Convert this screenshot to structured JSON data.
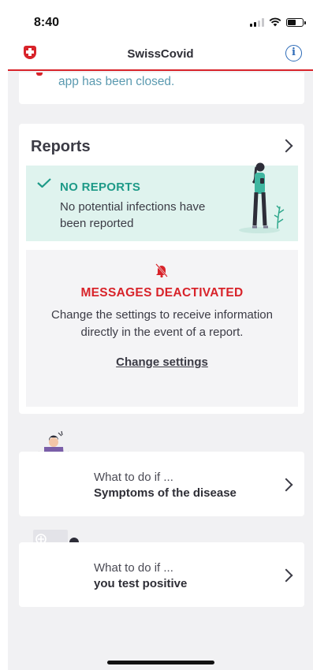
{
  "status_bar": {
    "time": "8:40",
    "battery_level": 0.55
  },
  "nav": {
    "title": "SwissCovid",
    "info_glyph": "i",
    "logo_icon": "swiss-cross-icon",
    "info_icon": "info-icon"
  },
  "tracing_card": {
    "text": "app has been closed."
  },
  "reports": {
    "title": "Reports",
    "status": {
      "icon": "checkmark-icon",
      "title": "NO REPORTS",
      "description": "No potential infections have been reported"
    },
    "messages": {
      "icon": "bell-off-icon",
      "title": "MESSAGES DEACTIVATED",
      "description": "Change the settings to receive information directly in the event of a report.",
      "link": "Change settings"
    }
  },
  "guides": [
    {
      "label": "What to do if ...",
      "subtitle": "Symptoms of the disease"
    },
    {
      "label": "What to do if ...",
      "subtitle": "you test positive"
    }
  ],
  "colors": {
    "brand_red": "#d8232a",
    "accent_teal": "#1e9a88",
    "info_blue": "#2e6cb8",
    "link_teal": "#5b9ab0",
    "report_bg": "#dff3ee"
  }
}
